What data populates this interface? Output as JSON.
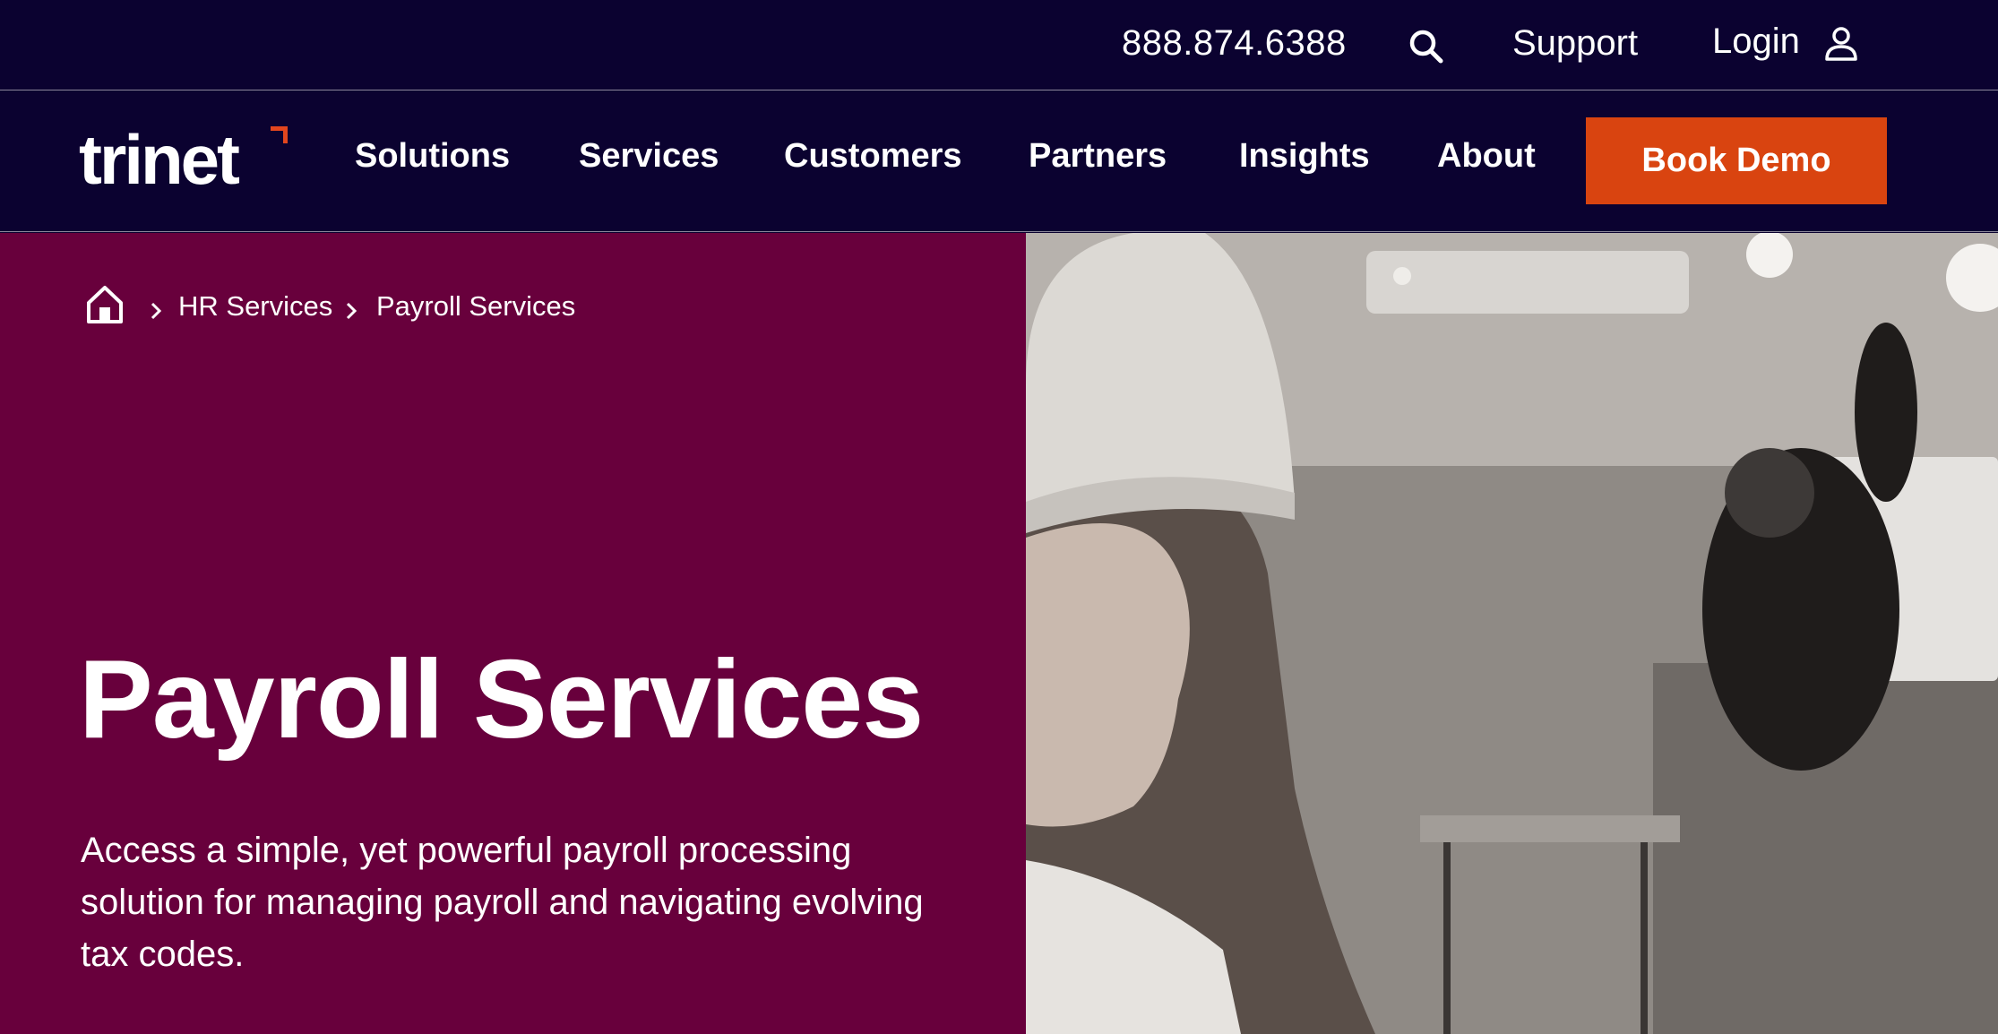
{
  "utility_bar": {
    "phone": "888.874.6388",
    "search_icon": "search-icon",
    "support_label": "Support",
    "login_label": "Login",
    "user_icon": "user-icon"
  },
  "nav": {
    "logo_text": "trinet",
    "items": [
      {
        "label": "Solutions"
      },
      {
        "label": "Services"
      },
      {
        "label": "Customers"
      },
      {
        "label": "Partners"
      },
      {
        "label": "Insights"
      },
      {
        "label": "About"
      }
    ],
    "cta_label": "Book Demo"
  },
  "breadcrumb": {
    "home_icon": "home-icon",
    "items": [
      "HR Services",
      "Payroll Services"
    ]
  },
  "hero": {
    "title": "Payroll Services",
    "description": "Access a simple, yet powerful payroll processing solution for managing payroll and navigating evolving tax codes."
  },
  "colors": {
    "nav_bg": "#0b0230",
    "hero_bg": "#68003c",
    "accent": "#d94410",
    "logo_mark": "#e2461e",
    "text": "#ffffff"
  }
}
